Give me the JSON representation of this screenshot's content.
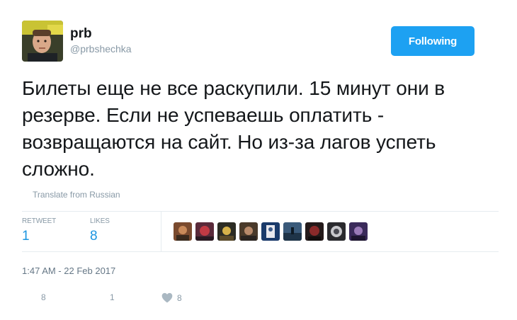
{
  "user": {
    "display_name": "prb",
    "handle": "@prbshechka"
  },
  "follow_button": {
    "label": "Following",
    "color": "#1da1f2"
  },
  "tweet": {
    "text": "Билеты еще не все раскупили. 15 минут они в резерве. Если не успеваешь оплатить - возвращаются на сайт. Но из-за лагов успеть сложно.",
    "translate_label": "Translate from Russian"
  },
  "stats": {
    "retweet_label": "RETWEET",
    "retweet_count": "1",
    "likes_label": "LIKES",
    "likes_count": "8"
  },
  "timestamp": "1:47 AM - 22 Feb 2017",
  "actions": {
    "reply_count": "8",
    "retweet_count": "1",
    "like_count": "8"
  },
  "colors": {
    "accent": "#1da1f2",
    "link": "#1b95e0",
    "muted": "#8899a6"
  }
}
